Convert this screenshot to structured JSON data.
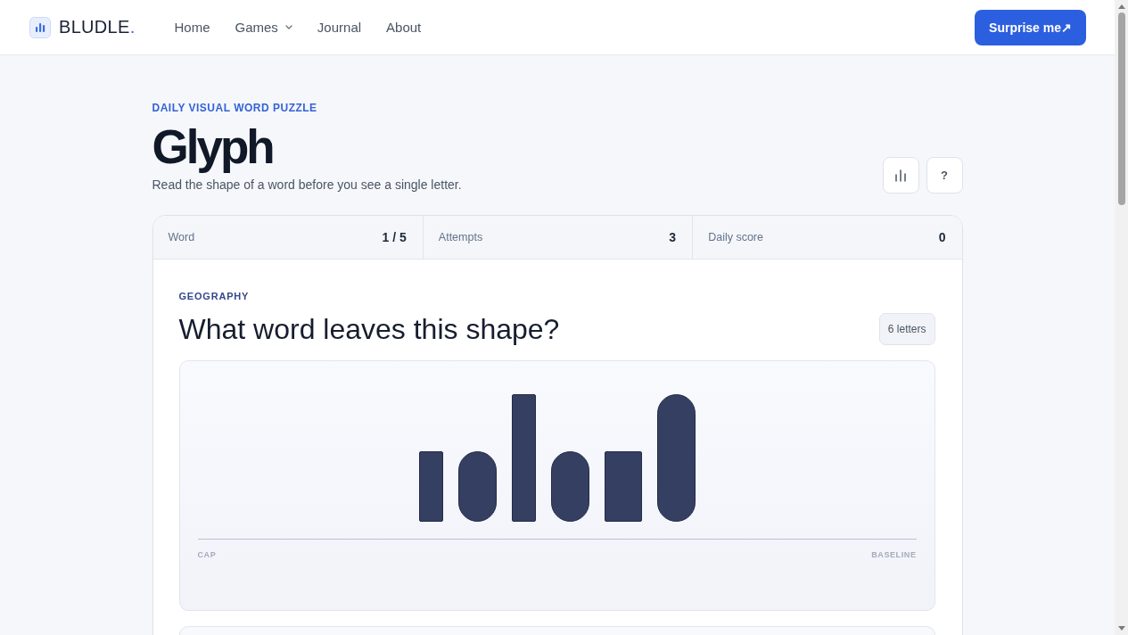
{
  "header": {
    "brand": {
      "name": "BLUDLE",
      "mark": "."
    },
    "nav": [
      {
        "label": "Home",
        "dropdown": false
      },
      {
        "label": "Games",
        "dropdown": true
      },
      {
        "label": "Journal",
        "dropdown": false
      },
      {
        "label": "About",
        "dropdown": false
      }
    ],
    "action": {
      "label": "Surprise me↗"
    }
  },
  "intro": {
    "eyebrow": "DAILY VISUAL WORD PUZZLE",
    "title": "Glyph",
    "subtitle": "Read the shape of a word before you see a single letter.",
    "tools": [
      {
        "kind": "chart"
      },
      {
        "kind": "text",
        "label": "?"
      }
    ]
  },
  "game": {
    "stats": [
      {
        "label": "Word",
        "value": "1 / 5"
      },
      {
        "label": "Attempts",
        "value": "3"
      },
      {
        "label": "Daily score",
        "value": "0"
      }
    ],
    "category": "GEOGRAPHY",
    "question": "What word leaves this shape?",
    "length_badge": "6 letters",
    "shape": {
      "glyphs": [
        {
          "kind": "stem",
          "tall": false
        },
        {
          "kind": "round",
          "tall": false
        },
        {
          "kind": "stem",
          "tall": true
        },
        {
          "kind": "round",
          "tall": false
        },
        {
          "kind": "block",
          "tall": false
        },
        {
          "kind": "round",
          "tall": true
        }
      ],
      "left_label": "CAP",
      "right_label": "BASELINE"
    }
  }
}
